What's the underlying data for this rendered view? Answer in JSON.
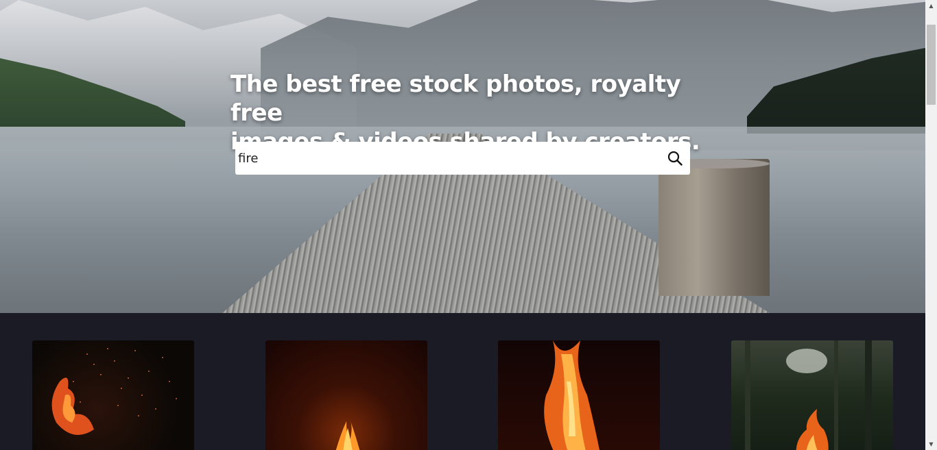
{
  "hero": {
    "title_line1": "The best free stock photos, royalty free",
    "title_line2": "images & videos shared by creators."
  },
  "search": {
    "value": "fire",
    "button_icon": "search-icon"
  },
  "results": {
    "thumbnails": [
      {
        "subject": "fire sparks on black background"
      },
      {
        "subject": "small flame in dark orange glow"
      },
      {
        "subject": "tall bonfire flames"
      },
      {
        "subject": "campfire in forest"
      }
    ]
  },
  "scrollbar": {
    "up_icon": "arrow-up-icon",
    "down_icon": "arrow-down-icon"
  }
}
